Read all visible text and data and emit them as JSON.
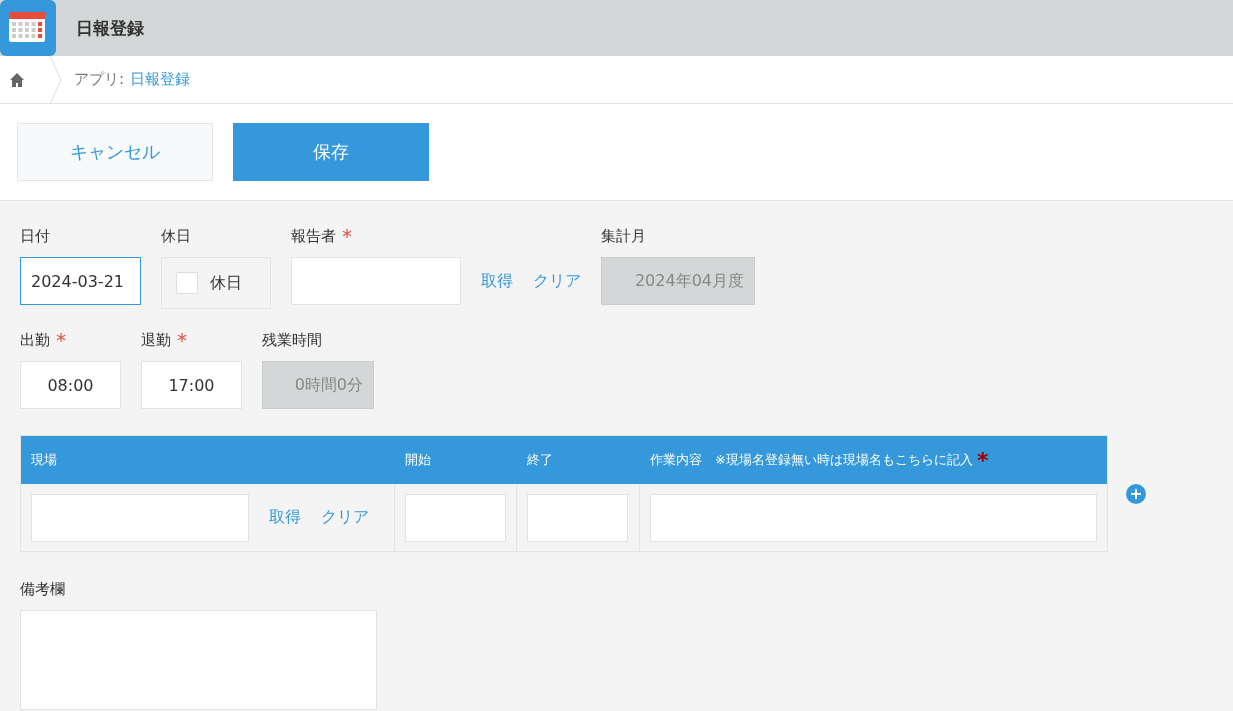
{
  "app": {
    "title": "日報登録"
  },
  "breadcrumb": {
    "prefix": "アプリ:",
    "link": "日報登録"
  },
  "toolbar": {
    "cancel": "キャンセル",
    "save": "保存"
  },
  "row1": [
    {
      "kind": "text",
      "label": "日付",
      "value": "2024-03-21",
      "focused": true
    },
    {
      "kind": "checkbox",
      "label": "休日",
      "option": "休日",
      "checked": false
    },
    {
      "kind": "lookup",
      "label": "報告者",
      "mark": "*",
      "get": "取得",
      "clear": "クリア"
    },
    {
      "kind": "readonly",
      "label": "集計月",
      "value": "2024年04月度"
    }
  ],
  "row2": [
    {
      "kind": "time",
      "label": "出勤",
      "mark": "*",
      "value": "08:00"
    },
    {
      "kind": "time",
      "label": "退勤",
      "mark": "*",
      "value": "17:00"
    },
    {
      "kind": "readonly",
      "label": "残業時間",
      "value": "0時間0分"
    }
  ],
  "table": {
    "columns": [
      {
        "label": "現場"
      },
      {
        "label": "開始"
      },
      {
        "label": "終了"
      },
      {
        "label": "作業内容　※現場名登録無い時は現場名もこちらに記入",
        "mark": "*"
      }
    ],
    "row": {
      "get": "取得",
      "clear": "クリア"
    }
  },
  "notes": {
    "label": "備考欄"
  }
}
